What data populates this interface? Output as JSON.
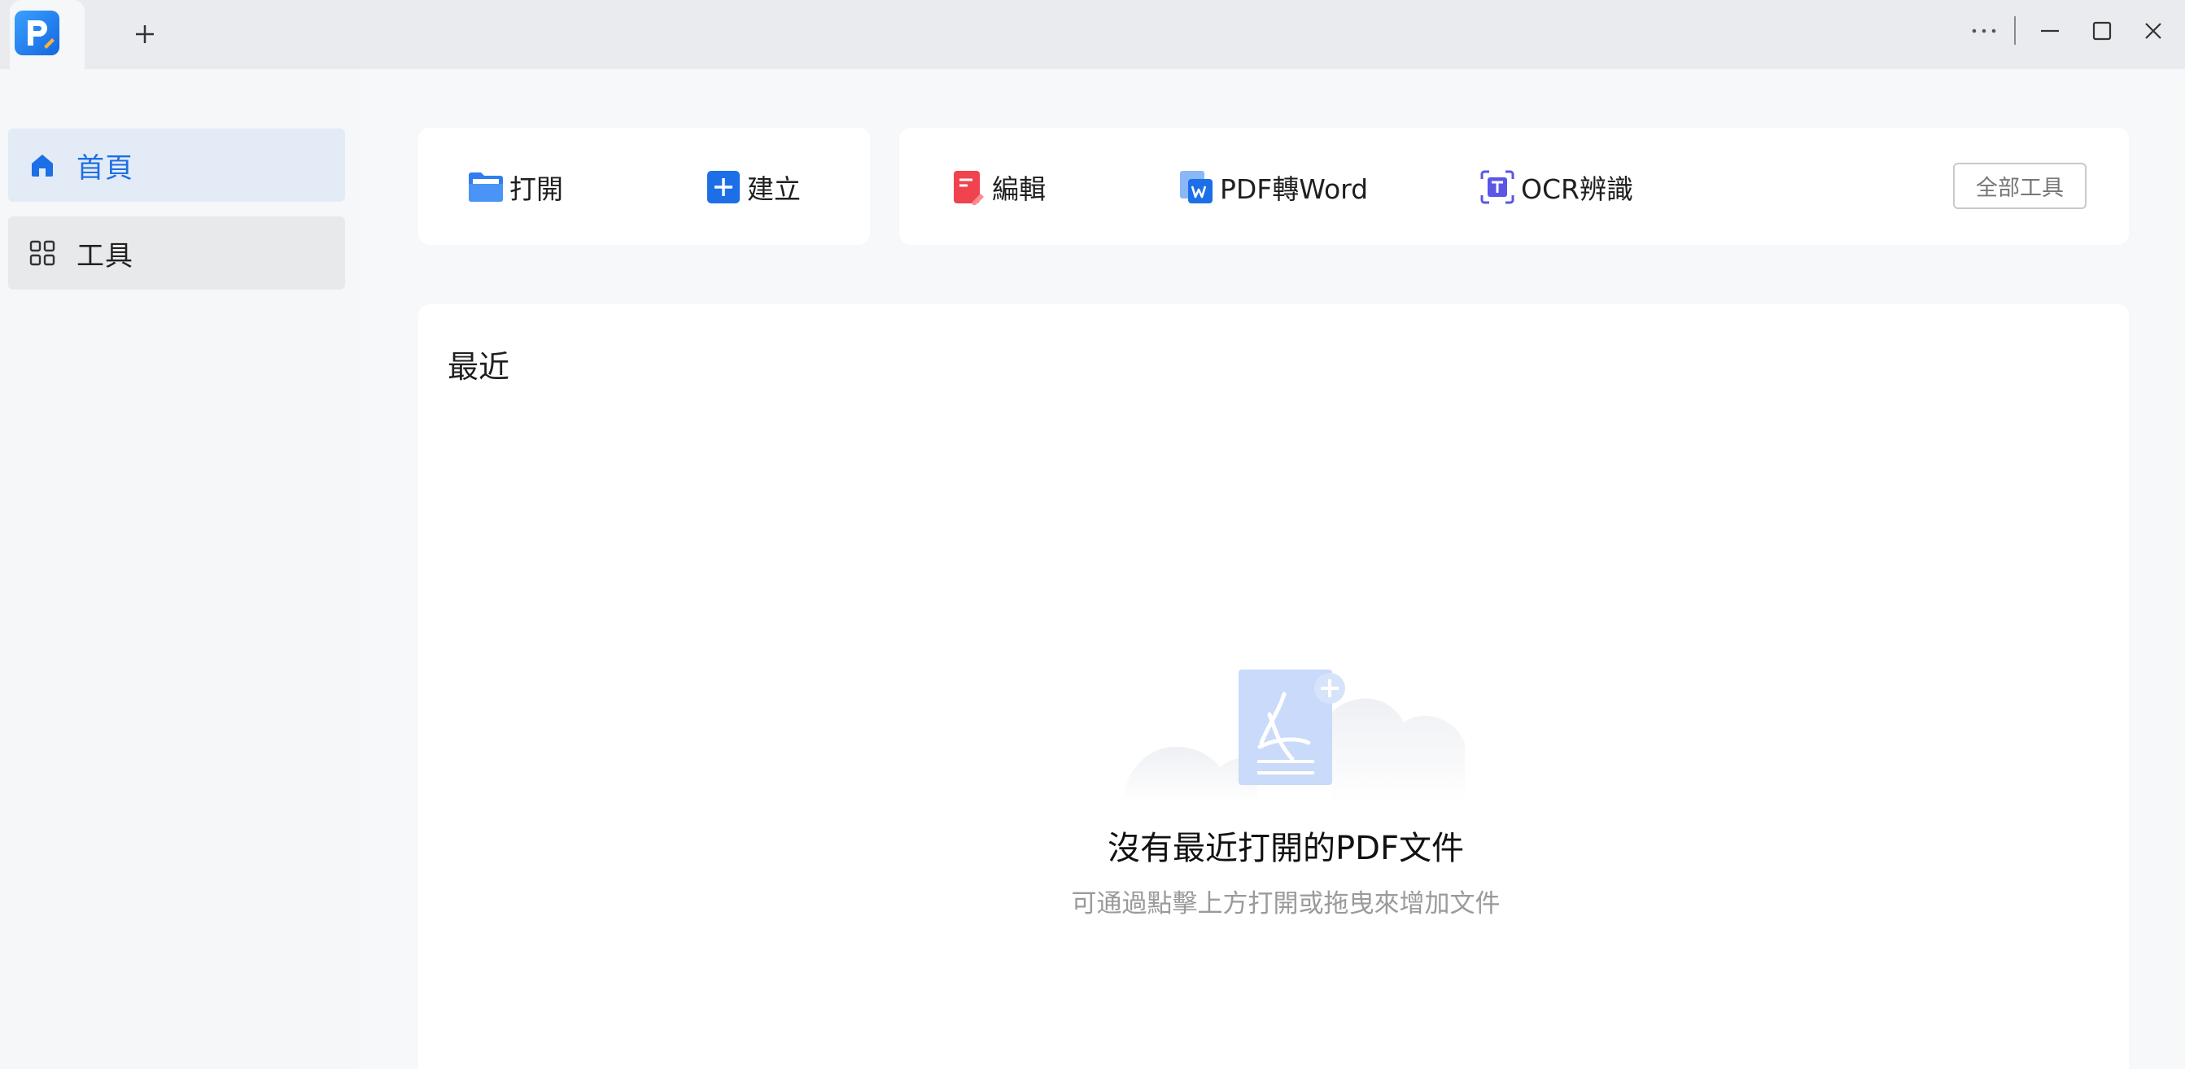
{
  "titlebar": {
    "new_tab_icon": "plus-icon",
    "controls": [
      "more-icon",
      "minimize-icon",
      "maximize-icon",
      "close-icon"
    ]
  },
  "sidebar": {
    "items": [
      {
        "label": "首頁",
        "icon": "home-icon",
        "active": true
      },
      {
        "label": "工具",
        "icon": "grid-icon",
        "active": false
      }
    ]
  },
  "quick_actions": {
    "open": {
      "label": "打開",
      "icon": "folder-icon"
    },
    "create": {
      "label": "建立",
      "icon": "plus-square-icon"
    }
  },
  "tools": {
    "edit": {
      "label": "編輯",
      "icon": "edit-doc-icon"
    },
    "pdf_to_word": {
      "label": "PDF轉Word",
      "icon": "word-icon"
    },
    "ocr": {
      "label": "OCR辨識",
      "icon": "ocr-icon"
    },
    "all_tools_label": "全部工具"
  },
  "recent": {
    "title": "最近",
    "empty_title": "沒有最近打開的PDF文件",
    "empty_subtitle": "可通過點擊上方打開或拖曳來增加文件"
  },
  "colors": {
    "accent": "#1c6fe6",
    "edit_red": "#f0434f",
    "ocr_purple": "#5a56e6",
    "sidebar_active_bg": "#e3ebf6"
  }
}
